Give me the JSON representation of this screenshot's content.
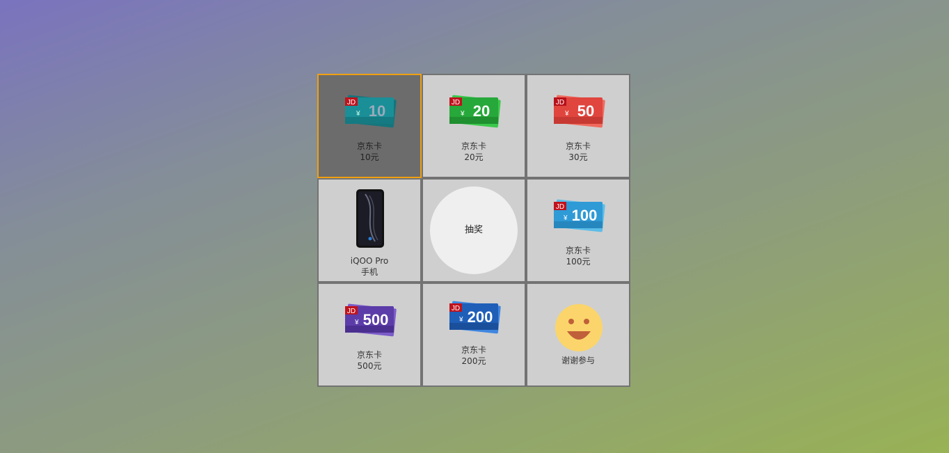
{
  "prizes": [
    {
      "name": "京东卡",
      "sub": "10元",
      "amount": "10",
      "color": "#1a8f97"
    },
    {
      "name": "京东卡",
      "sub": "20元",
      "amount": "20",
      "color": "#27a83a"
    },
    {
      "name": "京东卡",
      "sub": "30元",
      "amount": "50",
      "color": "#e0453e"
    },
    {
      "name": "iQOO Pro",
      "sub": "手机"
    },
    {
      "name": "京东卡",
      "sub": "100元",
      "amount": "100",
      "color": "#2e9ad6"
    },
    {
      "name": "京东卡",
      "sub": "500元",
      "amount": "500",
      "color": "#5b3ca8"
    },
    {
      "name": "京东卡",
      "sub": "200元",
      "amount": "200",
      "color": "#1f5fb8"
    },
    {
      "name": "谢谢参与"
    }
  ],
  "draw_button": {
    "label": "抽奖"
  },
  "card_badge": "JD",
  "currency_symbol": "¥",
  "colors": {
    "highlight_border": "#f0a010",
    "cell_bg": "#cfcfcf",
    "active_bg": "#6c6c6c"
  }
}
